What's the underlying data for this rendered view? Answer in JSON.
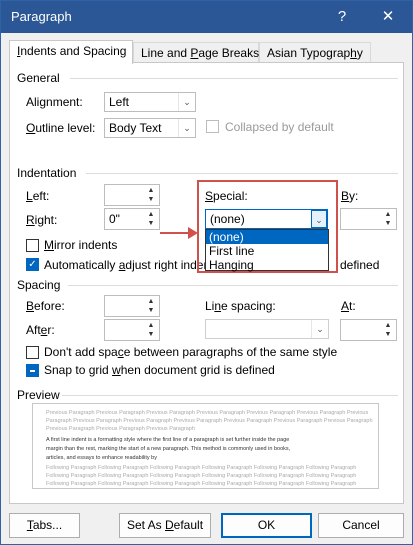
{
  "window": {
    "title": "Paragraph",
    "help": "?",
    "close": "✕"
  },
  "tabs": [
    {
      "label": "Indents and Spacing",
      "ul": "I",
      "rest": "ndents and Spacing"
    },
    {
      "label": "Line and Page Breaks",
      "pre": "Line and ",
      "ul": "P",
      "rest": "age Breaks"
    },
    {
      "label": "Asian Typography",
      "pre": "Asian Typograp",
      "ul": "h",
      "rest": "y"
    }
  ],
  "general": {
    "heading": "General",
    "alignment_label": {
      "pre": "Ali",
      "ul": "g",
      "rest": "nment:"
    },
    "alignment_value": "Left",
    "outline_label": {
      "ul": "O",
      "rest": "utline level:"
    },
    "outline_value": "Body Text",
    "collapsed_label": "Collapsed by default"
  },
  "indentation": {
    "heading": "Indentation",
    "left_label": {
      "ul": "L",
      "rest": "eft:"
    },
    "left_value": "",
    "right_label": {
      "ul": "R",
      "rest": "ight:"
    },
    "right_value": "0\"",
    "special_label": {
      "ul": "S",
      "rest": "pecial:"
    },
    "special_value": "(none)",
    "by_label": {
      "ul": "B",
      "rest": "y:"
    },
    "by_value": "",
    "special_options": [
      "(none)",
      "First line",
      "Hanging"
    ],
    "mirror_label": {
      "ul": "M",
      "rest": "irror indents"
    },
    "auto_adjust_label": {
      "pre": "Automatically ",
      "ul": "a",
      "rest": "djust right inden"
    },
    "auto_adjust_tail": "defined"
  },
  "spacing": {
    "heading": "Spacing",
    "before_label": {
      "ul": "B",
      "rest": "efore:"
    },
    "before_value": "",
    "after_label": {
      "pre": "Aft",
      "ul": "e",
      "rest": "r:"
    },
    "after_value": "",
    "line_spacing_label": {
      "pre": "Li",
      "ul": "n",
      "rest": "e spacing:"
    },
    "line_spacing_value": "",
    "at_label": {
      "ul": "A",
      "rest": "t:"
    },
    "at_value": "",
    "dont_add_label": {
      "pre": "Don't add spa",
      "ul": "c",
      "rest": "e between paragraphs of the same style"
    },
    "snap_label": {
      "pre": "Snap to grid ",
      "ul": "w",
      "rest": "hen document grid is defined"
    }
  },
  "preview": {
    "heading": "Preview",
    "prev_lines": [
      "Previous Paragraph Previous Paragraph Previous Paragraph Previous Paragraph Previous Paragraph Previous Paragraph Previous",
      "Paragraph Previous Paragraph Previous Paragraph Previous Paragraph Previous Paragraph Previous Paragraph Previous Paragraph",
      "Previous Paragraph Previous Paragraph Previous Paragraph"
    ],
    "main_lines": [
      "A first line indent is a formatting style where the first line of a paragraph is set further inside the page",
      "margin than the rest, marking the start of a new paragraph. This method is commonly used in books,",
      "articles, and essays to enhance readability by"
    ],
    "follow_lines": [
      "Following Paragraph Following Paragraph Following Paragraph Following Paragraph Following Paragraph Following Paragraph",
      "Following Paragraph Following Paragraph Following Paragraph Following Paragraph Following Paragraph Following Paragraph",
      "Following Paragraph Following Paragraph Following Paragraph Following Paragraph Following Paragraph Following Paragraph"
    ]
  },
  "buttons": {
    "tabs": {
      "ul": "T",
      "rest": "abs..."
    },
    "set_default": {
      "pre": "Set As ",
      "ul": "D",
      "rest": "efault"
    },
    "ok": "OK",
    "cancel": "Cancel"
  },
  "colors": {
    "accent": "#0067c0",
    "titlebar": "#2b5797",
    "highlight": "#d0504b"
  }
}
